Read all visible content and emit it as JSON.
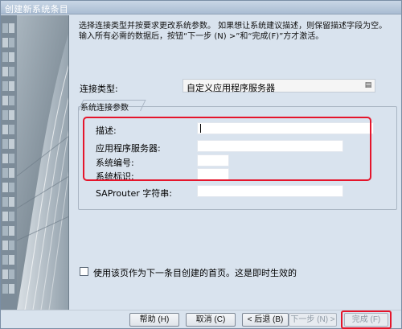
{
  "window": {
    "title": "创建新系统条目"
  },
  "instructions": "选择连接类型并按要求更改系统参数。 如果想让系统建议描述，则保留描述字段为空。 输入所有必需的数据后，按钮“下一步 (N) >”和“完成(F)”方才激活。",
  "connection_type": {
    "label": "连接类型:",
    "value": "自定义应用程序服务器"
  },
  "group": {
    "title": "系统连接参数",
    "fields": [
      {
        "label": "描述:",
        "value": ""
      },
      {
        "label": "应用程序服务器:",
        "value": ""
      },
      {
        "label": "系统编号:",
        "value": ""
      },
      {
        "label": "系统标识:",
        "value": ""
      },
      {
        "label": "SAProuter 字符串:",
        "value": ""
      }
    ]
  },
  "checkbox": {
    "label": "使用该页作为下一条目创建的首页。这是即时生效的",
    "checked": false
  },
  "buttons": {
    "help": "帮助 (H)",
    "cancel": "取消 (C)",
    "back": "< 后退 (B)",
    "next": "下一步 (N) >",
    "finish": "完成 (F)"
  },
  "colors": {
    "highlight": "#e5152b",
    "background": "#d9e3ee"
  }
}
